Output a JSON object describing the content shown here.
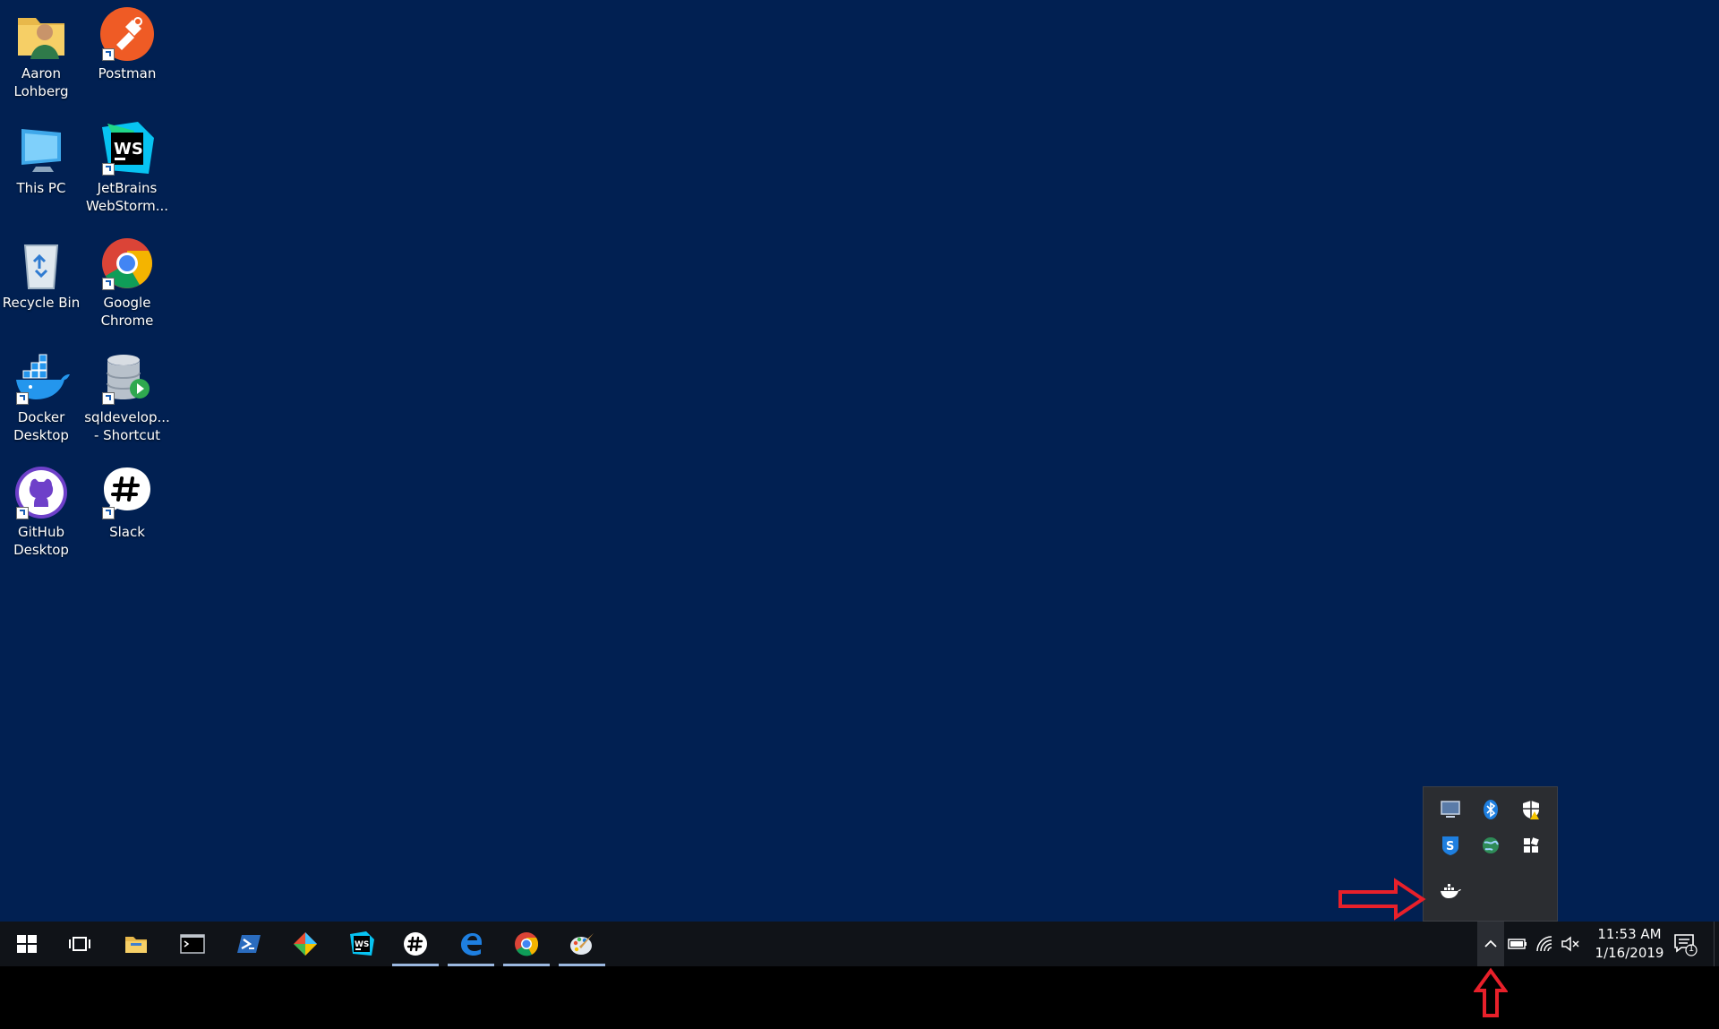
{
  "desktop": {
    "background": "#012052",
    "icons": [
      {
        "label": "Aaron Lohberg",
        "icon": "user-folder-icon"
      },
      {
        "label": "Postman",
        "icon": "postman-icon"
      },
      {
        "label": "This PC",
        "icon": "computer-icon"
      },
      {
        "label": "JetBrains WebStorm...",
        "icon": "webstorm-icon"
      },
      {
        "label": "Recycle Bin",
        "icon": "recycle-bin-icon"
      },
      {
        "label": "Google Chrome",
        "icon": "chrome-icon"
      },
      {
        "label": "Docker Desktop",
        "icon": "docker-icon"
      },
      {
        "label": "sqldevelop... - Shortcut",
        "icon": "sql-developer-icon"
      },
      {
        "label": "GitHub Desktop",
        "icon": "github-icon"
      },
      {
        "label": "Slack",
        "icon": "slack-icon"
      }
    ]
  },
  "taskbar": {
    "background": "#101318",
    "pinned": [
      {
        "name": "start",
        "icon": "windows-start-icon",
        "open": false
      },
      {
        "name": "task-view",
        "icon": "task-view-icon",
        "open": false
      },
      {
        "name": "file-explorer",
        "icon": "folder-icon",
        "open": false
      },
      {
        "name": "command-prompt",
        "icon": "cmd-icon",
        "open": false
      },
      {
        "name": "powershell",
        "icon": "powershell-icon",
        "open": false
      },
      {
        "name": "git-kraken",
        "icon": "git-icon",
        "open": false
      },
      {
        "name": "webstorm",
        "icon": "webstorm-icon",
        "open": false
      },
      {
        "name": "slack",
        "icon": "slack-icon",
        "open": true
      },
      {
        "name": "edge",
        "icon": "edge-icon",
        "open": true
      },
      {
        "name": "chrome",
        "icon": "chrome-icon",
        "open": true
      },
      {
        "name": "paint",
        "icon": "paint-icon",
        "open": true
      }
    ],
    "tray": {
      "icons": [
        "battery-icon",
        "wifi-icon",
        "volume-muted-icon"
      ],
      "clock": {
        "time": "11:53 AM",
        "date": "1/16/2019"
      },
      "notifications": "1"
    }
  },
  "tray_popup": {
    "icons": [
      "display-icon",
      "bluetooth-icon",
      "defender-warning-icon",
      "sophos-shield-icon",
      "network-globe-icon",
      "settings-puzzle-icon",
      "docker-whale-icon"
    ]
  },
  "annotation": {
    "color": "#e8202a"
  }
}
